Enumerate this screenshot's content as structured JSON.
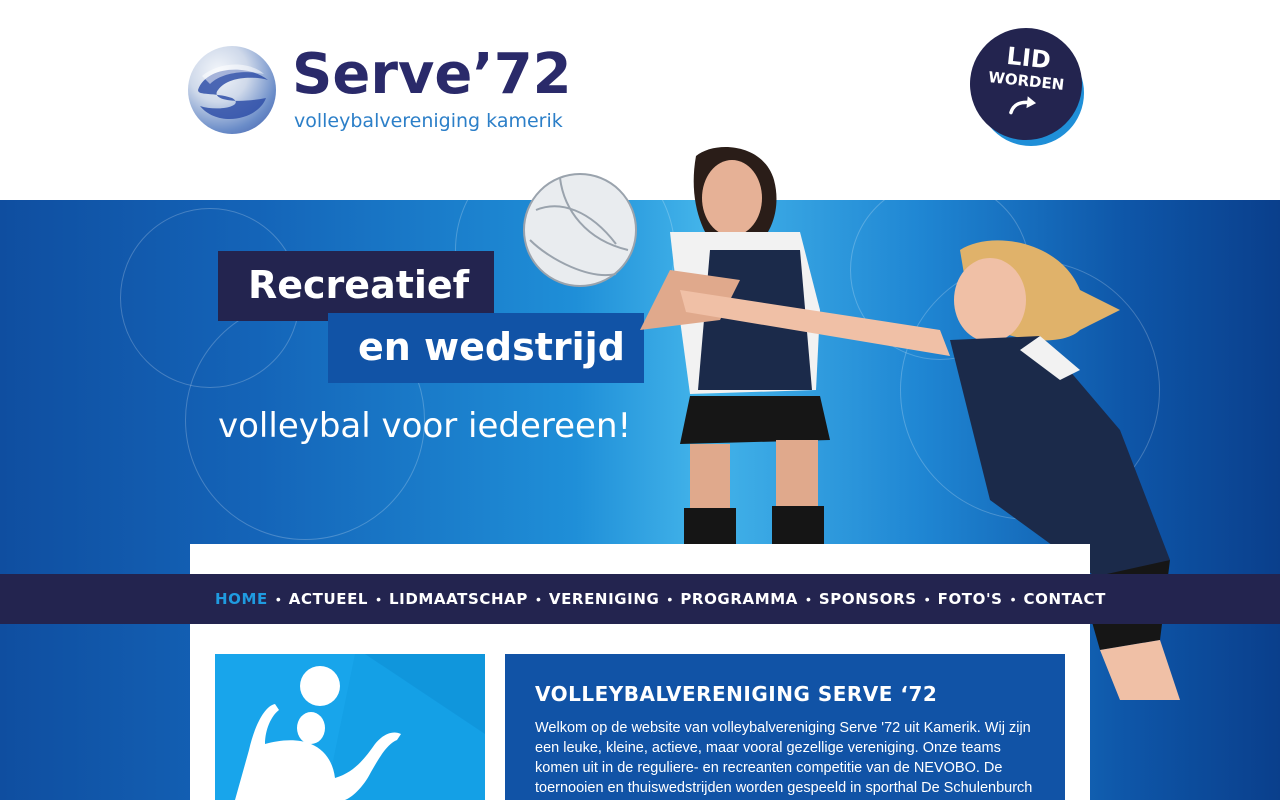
{
  "header": {
    "logo_title": "Serve’72",
    "logo_subtitle": "volleybalvereniging kamerik",
    "cta_line1": "LID",
    "cta_line2": "WORDEN"
  },
  "hero": {
    "tag_line1": "Recreatief",
    "tag_line2": "en wedstrijd",
    "tagline": "volleybal voor iedereen!"
  },
  "nav": {
    "items": [
      {
        "label": "HOME",
        "active": true
      },
      {
        "label": "ACTUEEL",
        "active": false
      },
      {
        "label": "LIDMAATSCHAP",
        "active": false
      },
      {
        "label": "VERENIGING",
        "active": false
      },
      {
        "label": "PROGRAMMA",
        "active": false
      },
      {
        "label": "SPONSORS",
        "active": false
      },
      {
        "label": "FOTO'S",
        "active": false
      },
      {
        "label": "CONTACT",
        "active": false
      }
    ],
    "separator": "•"
  },
  "content": {
    "title": "VOLLEYBALVERENIGING SERVE ‘72",
    "text": "Welkom op de website van volleybalvereniging Serve '72 uit Kamerik. Wij zijn een leuke, kleine, actieve, maar vooral gezellige vereniging. Onze teams komen uit in de reguliere- en recreanten competitie van de NEVOBO. De toernooien en thuiswedstrijden worden gespeeld in sporthal De Schulenburch te Kamerik (het"
  },
  "colors": {
    "navy": "#23244f",
    "blue": "#1153a6",
    "accent": "#1f9be0",
    "logo_blue": "#2c7fc8"
  },
  "icons": {
    "logo": "volleyball-logo-icon",
    "cta_arrow": "curved-arrow-icon"
  }
}
